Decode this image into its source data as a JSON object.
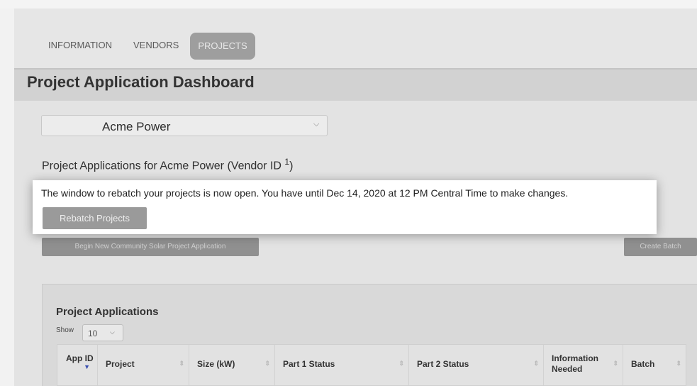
{
  "nav": {
    "items": [
      {
        "label": "INFORMATION"
      },
      {
        "label": "VENDORS"
      },
      {
        "label": "PROJECTS",
        "active": true
      }
    ]
  },
  "page": {
    "title": "Project Application Dashboard"
  },
  "vendor_select": {
    "value": "Acme Power"
  },
  "section": {
    "heading": "Project Applications for Acme Power (Vendor ID",
    "vendor_id": "1",
    "heading_close": ")"
  },
  "notice": {
    "text": "The window to rebatch your projects is now open. You have until Dec 14, 2020 at 12 PM Central Time to make changes.",
    "rebatch_label": "Rebatch Projects"
  },
  "actions": {
    "begin_label": "Begin New Community Solar Project Application",
    "create_batch_label": "Create Batch"
  },
  "applications": {
    "title": "Project Applications",
    "show_label": "Show",
    "show_value": "10",
    "columns": [
      {
        "label": "App ID"
      },
      {
        "label": "Project"
      },
      {
        "label": "Size (kW)"
      },
      {
        "label": "Part 1 Status"
      },
      {
        "label": "Part 2 Status"
      },
      {
        "label": "Information Needed"
      },
      {
        "label": "Batch"
      }
    ]
  },
  "colors": {
    "highlight_bg": "#ffffff",
    "dim_bg": "#e3e3e3",
    "button_gray": "#9a9a9a",
    "sort_active": "#3a4fb0"
  }
}
